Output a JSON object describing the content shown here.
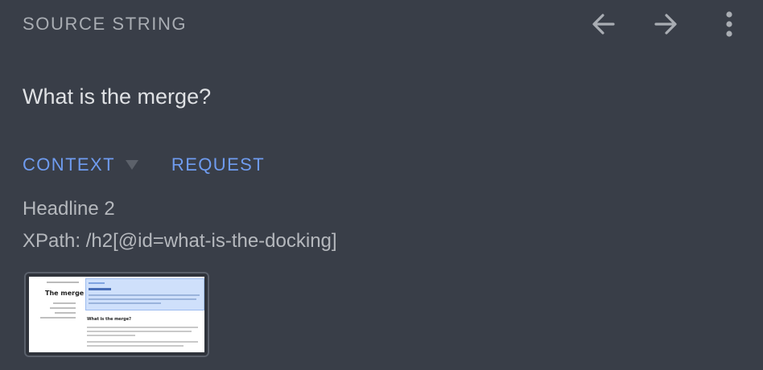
{
  "header": {
    "title": "SOURCE STRING",
    "icons": [
      "arrow-left-icon",
      "arrow-right-icon",
      "more-vertical-icon"
    ]
  },
  "source": {
    "text": "What is the merge?"
  },
  "tabs": [
    {
      "label": "CONTEXT",
      "has_dropdown": true
    },
    {
      "label": "REQUEST"
    }
  ],
  "context": {
    "type_label": "Headline 2",
    "xpath": "XPath: /h2[@id=what-is-the-docking]"
  },
  "thumbnail": {
    "page_title": "The merge",
    "section_heading": "What is the merge?"
  },
  "colors": {
    "background": "#393e48",
    "accent": "#6f9cf0",
    "muted_text": "#a9adb3",
    "primary_text": "#dfe1e4"
  }
}
